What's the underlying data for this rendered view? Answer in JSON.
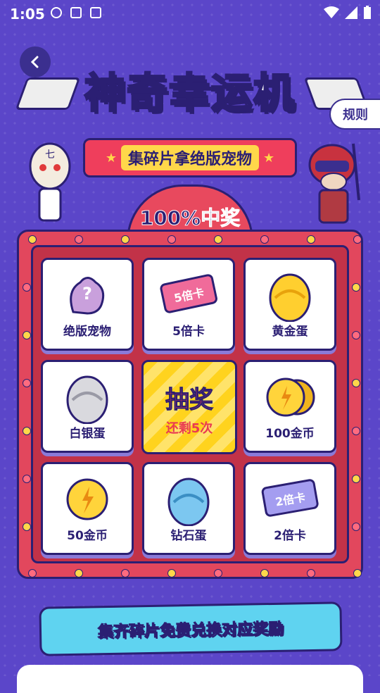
{
  "status_bar": {
    "time": "1:05"
  },
  "header": {
    "title": "神奇幸运机",
    "rules_label": "规则"
  },
  "banner": {
    "subtitle": "集碎片拿绝版宠物",
    "guarantee": "100%中奖"
  },
  "grid": {
    "items": [
      {
        "label": "绝版宠物",
        "icon": "mystery-pet-icon"
      },
      {
        "label": "5倍卡",
        "icon": "card-5x-icon",
        "card_text": "5倍卡"
      },
      {
        "label": "黄金蛋",
        "icon": "gold-egg-icon"
      },
      {
        "label": "白银蛋",
        "icon": "silver-egg-icon"
      },
      {
        "label": "100金币",
        "icon": "gold-coins-icon"
      },
      {
        "label": "50金币",
        "icon": "gold-coin-icon"
      },
      {
        "label": "钻石蛋",
        "icon": "diamond-egg-icon"
      },
      {
        "label": "2倍卡",
        "icon": "card-2x-icon",
        "card_text": "2倍卡"
      }
    ],
    "center": {
      "title": "抽奖",
      "remaining": "还剩5次"
    }
  },
  "footer": {
    "text": "集齐碎片免费兑换对应奖励"
  },
  "colors": {
    "background": "#5b46c9",
    "board": "#e2475d",
    "accent": "#ffd31e",
    "outline": "#2b1f73"
  }
}
